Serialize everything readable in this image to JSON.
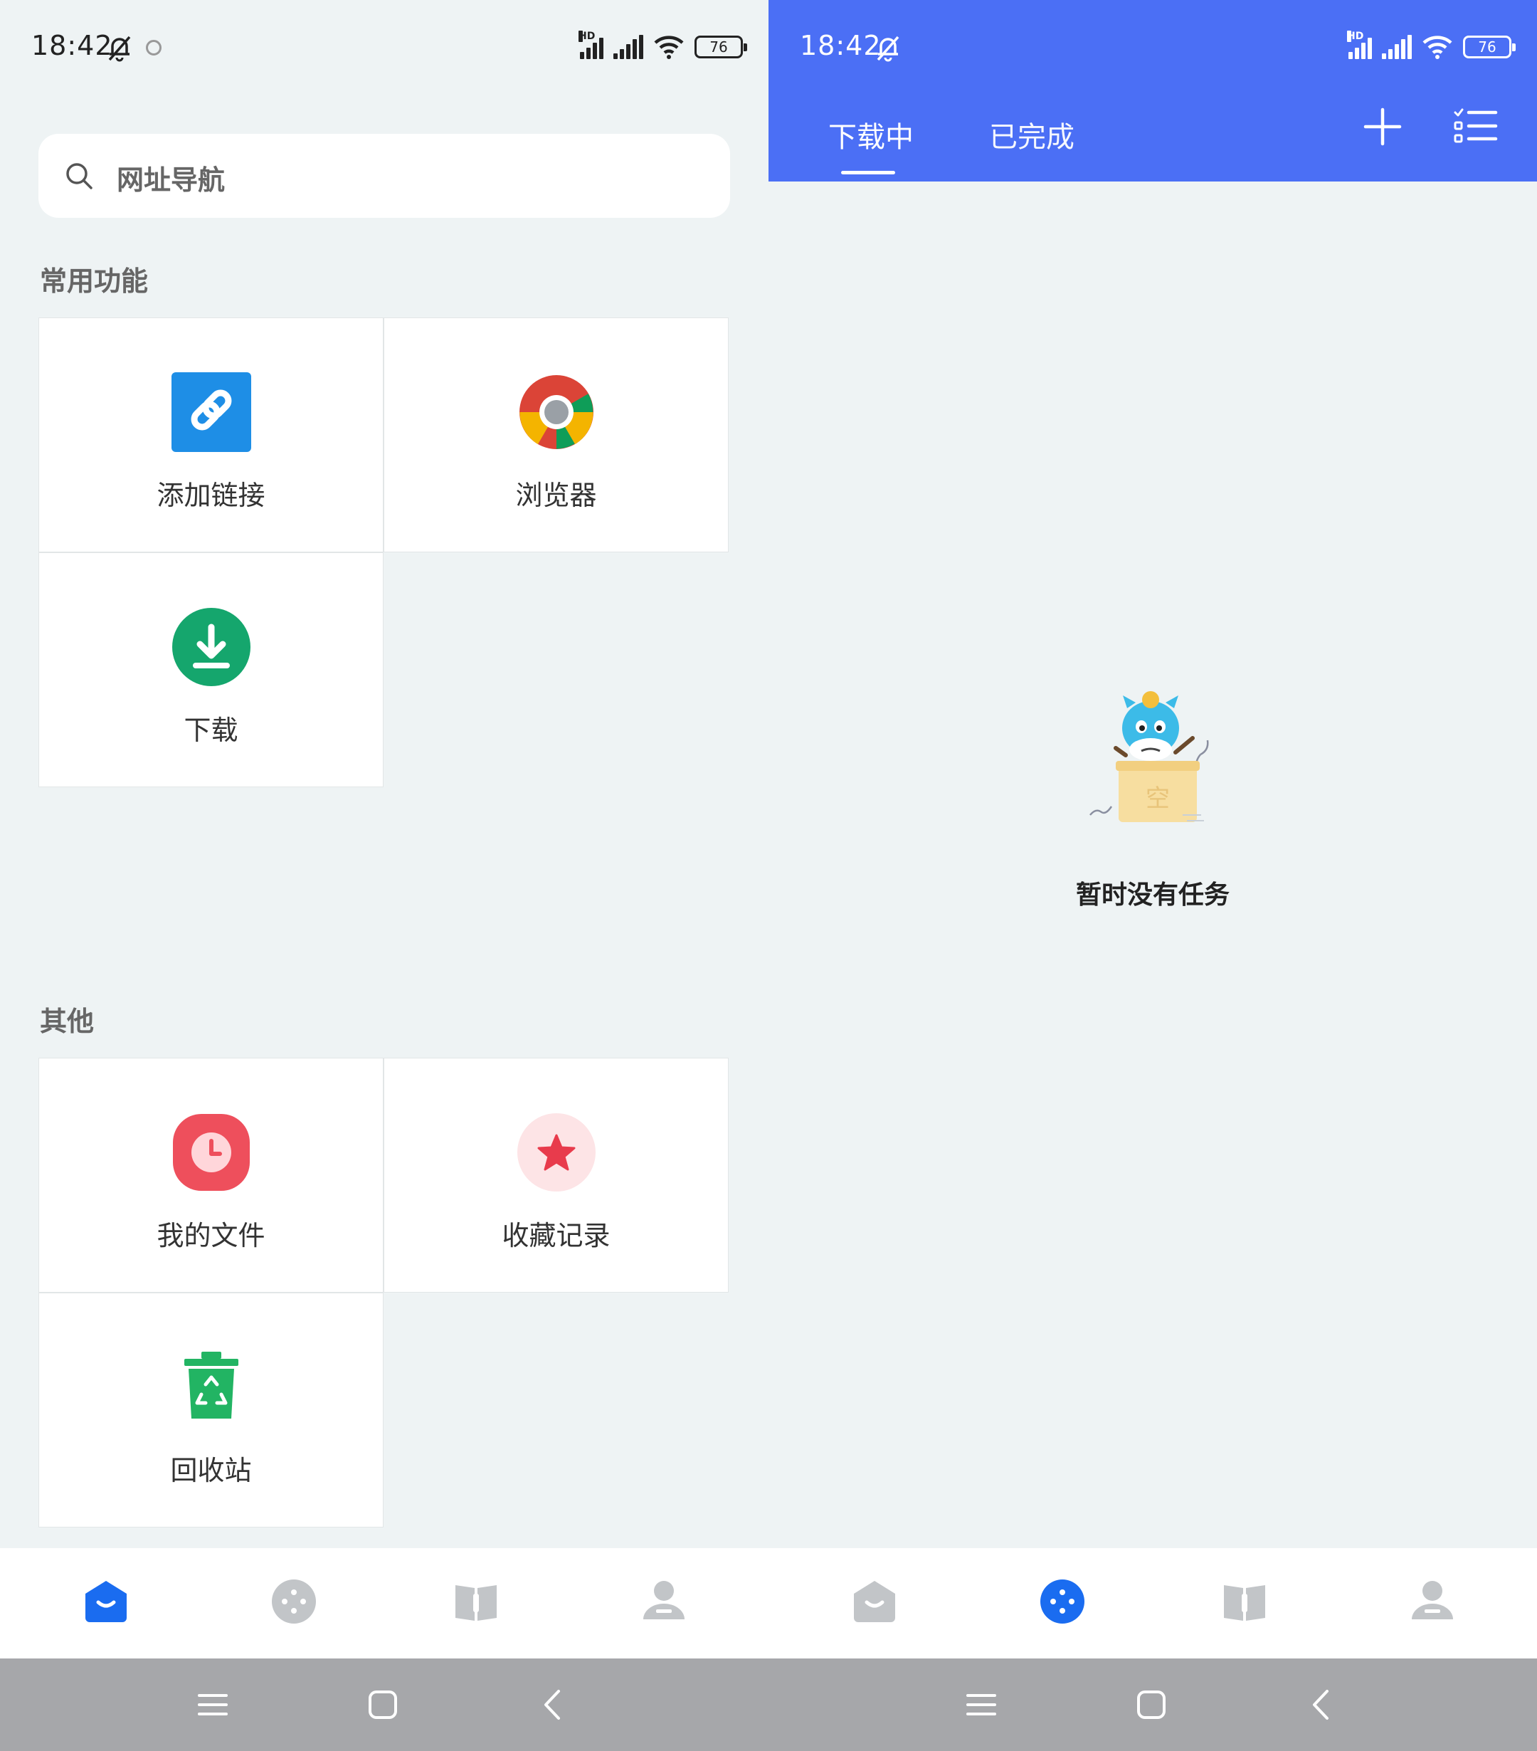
{
  "left": {
    "status": {
      "time": "18:42",
      "battery": "76"
    },
    "search": {
      "placeholder": "网址导航"
    },
    "sections": {
      "common": "常用功能",
      "other": "其他"
    },
    "common_items": [
      {
        "label": "添加链接",
        "icon": "link-icon",
        "color": "#1e8ee6"
      },
      {
        "label": "浏览器",
        "icon": "browser-icon"
      },
      {
        "label": "下载",
        "icon": "download-icon",
        "color": "#15a66d"
      }
    ],
    "other_items": [
      {
        "label": "我的文件",
        "icon": "clock-icon",
        "color": "#ee4f5c"
      },
      {
        "label": "收藏记录",
        "icon": "star-icon",
        "color": "#e83b4c"
      },
      {
        "label": "回收站",
        "icon": "recycle-bin-icon",
        "color": "#22b463"
      }
    ],
    "nav_active": "home"
  },
  "right": {
    "status": {
      "time": "18:42",
      "battery": "76"
    },
    "tabs": [
      "下载中",
      "已完成"
    ],
    "active_tab": "下载中",
    "empty_text": "暂时没有任务",
    "illustration_text": "空",
    "nav_active": "discover",
    "accent": "#4b6ff5"
  }
}
